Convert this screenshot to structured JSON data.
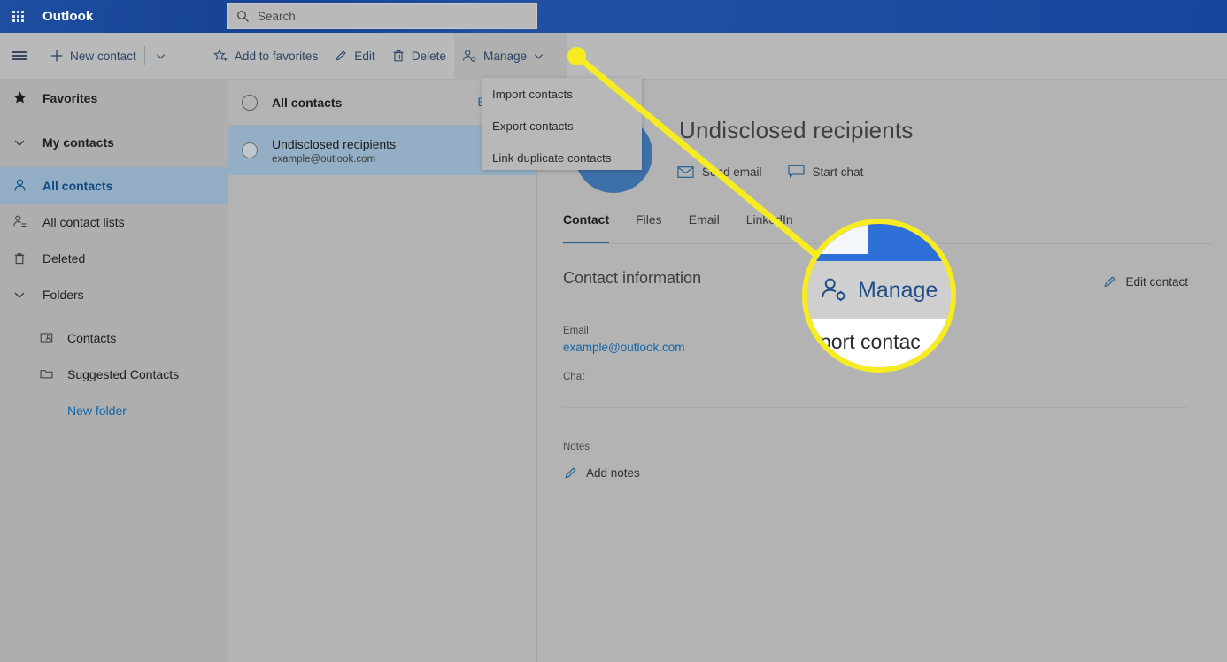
{
  "topbar": {
    "waffle_icon": "app-launcher-icon",
    "brand": "Outlook",
    "search_placeholder": "Search",
    "search_value": "",
    "search_icon": "search-icon"
  },
  "toolbar": {
    "hamburger_icon": "hamburger-menu-icon",
    "new_contact": "New contact",
    "new_contact_icon": "plus-icon",
    "new_contact_caret_icon": "chevron-down-icon",
    "add_favorites": "Add to favorites",
    "add_favorites_icon": "star-add-icon",
    "edit": "Edit",
    "edit_icon": "pencil-icon",
    "delete": "Delete",
    "delete_icon": "trash-icon",
    "manage": "Manage",
    "manage_icon": "person-gear-icon",
    "manage_caret_icon": "chevron-down-icon"
  },
  "dropdown": {
    "items": [
      {
        "label": "Import contacts"
      },
      {
        "label": "Export contacts"
      },
      {
        "label": "Link duplicate contacts"
      }
    ]
  },
  "sidebar": {
    "items": [
      {
        "label": "Favorites",
        "icon": "star-filled-icon"
      },
      {
        "label": "My contacts",
        "icon": "chevron-down-icon"
      },
      {
        "label": "All contacts",
        "icon": "person-icon"
      },
      {
        "label": "All contact lists",
        "icon": "people-list-icon"
      },
      {
        "label": "Deleted",
        "icon": "trash-icon"
      },
      {
        "label": "Folders",
        "icon": "chevron-down-icon"
      },
      {
        "label": "Contacts",
        "icon": "contact-card-icon"
      },
      {
        "label": "Suggested Contacts",
        "icon": "folder-icon"
      },
      {
        "label": "New folder",
        "icon": "none"
      }
    ]
  },
  "list": {
    "header_title": "All contacts",
    "sort_label": "By first n",
    "header_radio_icon": "radio-unchecked-icon",
    "items": [
      {
        "name": "Undisclosed recipients",
        "email": "example@outlook.com",
        "radio_icon": "radio-unchecked-icon"
      }
    ]
  },
  "detail": {
    "avatar_icon": "contact-avatar",
    "title": "Undisclosed recipients",
    "actions": [
      {
        "label": "Send email",
        "icon": "envelope-icon"
      },
      {
        "label": "Start chat",
        "icon": "chat-bubble-icon"
      }
    ],
    "tabs": [
      {
        "label": "Contact",
        "selected": true
      },
      {
        "label": "Files",
        "selected": false
      },
      {
        "label": "Email",
        "selected": false
      },
      {
        "label": "LinkedIn",
        "selected": false
      }
    ],
    "contact_info_heading": "Contact information",
    "edit_contact": "Edit contact",
    "edit_contact_icon": "pencil-icon",
    "fields": [
      {
        "label": "Email",
        "value": "example@outlook.com"
      },
      {
        "label": "Chat",
        "value": ""
      }
    ],
    "notes_label": "Notes",
    "add_notes": "Add notes",
    "add_notes_icon": "pencil-icon"
  },
  "annotation": {
    "magnifier_label": "Manage",
    "magnifier_icon": "person-gear-icon",
    "magnifier_caret_icon": "chevron-down-icon",
    "magnifier_under_text": "port contac",
    "highlight_color": "#f7ec21",
    "callout_dot_icon": "callout-dot"
  }
}
